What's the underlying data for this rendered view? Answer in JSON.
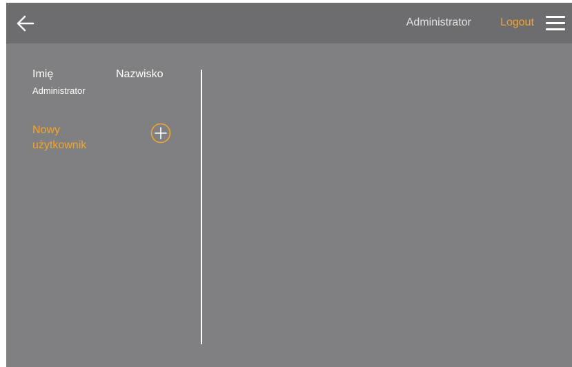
{
  "header": {
    "back_icon": "arrow-left-icon",
    "user": "Administrator",
    "logout_label": "Logout",
    "menu_icon": "hamburger-menu-icon"
  },
  "users_table": {
    "columns": {
      "first_name": "Imię",
      "last_name": "Nazwisko"
    },
    "rows": [
      {
        "name": "Administrator"
      }
    ]
  },
  "new_user": {
    "label": "Nowy użytkownik",
    "icon": "plus-circle-icon"
  },
  "colors": {
    "accent": "#f2a52a",
    "background": "#808083",
    "header": "#6d6d70",
    "text": "#ffffff"
  }
}
